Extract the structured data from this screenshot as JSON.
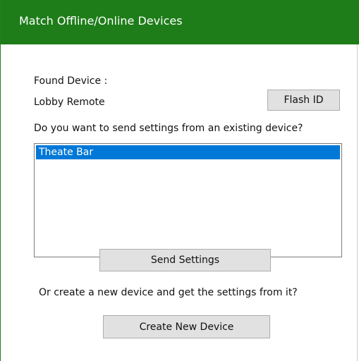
{
  "dialog": {
    "title": "Match Offline/Online Devices",
    "found_device_label": "Found Device :",
    "device_name": "Lobby Remote",
    "flash_id_button": "Flash ID",
    "question_existing": "Do you want to send settings from an existing device?",
    "devices_list": [
      {
        "label": "Theate Bar",
        "selected": true
      }
    ],
    "send_settings_button": "Send Settings",
    "question_new": "Or create a new device and get the settings from it?",
    "create_new_device_button": "Create New Device"
  },
  "colors": {
    "titlebar": "#1e7d19",
    "selection": "#0078d7",
    "button_face": "#e1e1e1"
  }
}
